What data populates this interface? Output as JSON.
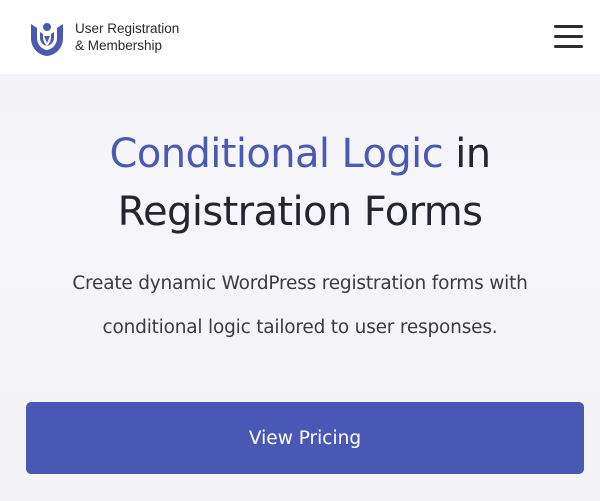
{
  "header": {
    "logo_line1": "User Registration",
    "logo_line2": "& Membership",
    "logo_icon": "ur-logo-icon",
    "menu_icon": "hamburger-menu-icon"
  },
  "hero": {
    "title_accent": "Conditional Logic",
    "title_rest_line1": " in",
    "title_line2": "Registration Forms",
    "subtitle_line1": "Create dynamic WordPress registration forms with",
    "subtitle_line2": "conditional logic tailored to user responses."
  },
  "cta": {
    "label": "View Pricing"
  },
  "colors": {
    "accent": "#4a59b1",
    "button": "#4a58b5",
    "text": "#25252d"
  }
}
